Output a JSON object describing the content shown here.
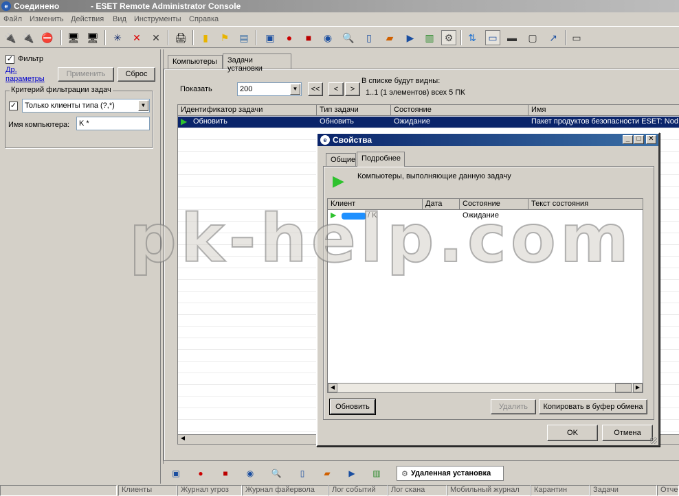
{
  "titlebar": {
    "status": "Соединено",
    "app_title": "- ESET Remote Administrator Console"
  },
  "menu": [
    "Файл",
    "Изменить",
    "Действия",
    "Вид",
    "Инструменты",
    "Справка"
  ],
  "toolbar": {
    "icons": [
      "connect-icon",
      "connect-all-icon",
      "disconnect-icon",
      "computer-icon",
      "computers-icon",
      "new-task-icon",
      "delete-icon",
      "close-icon",
      "print-icon",
      "export-icon",
      "flag-icon",
      "document-icon",
      "clients-icon",
      "threat-icon",
      "firewall-icon",
      "events-icon",
      "scan-icon",
      "mobile-icon",
      "quarantine-icon",
      "tasks-icon",
      "reports-icon",
      "remote-install-icon",
      "refresh-icon",
      "panel-icon",
      "filter-icon",
      "view-icon",
      "send-icon",
      "options-icon"
    ]
  },
  "filter": {
    "enabled_label": "Фильтр",
    "more_link": "Др. параметры",
    "apply_label": "Применить",
    "reset_label": "Сброс",
    "criteria_title": "Критерий фильтрации задач",
    "client_type_value": "Только клиенты типа (?,*)",
    "computer_name_label": "Имя компьютера:",
    "computer_name_value": "K *"
  },
  "tabs": [
    "Компьютеры",
    "Задачи установки"
  ],
  "show": {
    "label": "Показать",
    "value": "200",
    "prev_all": "<<",
    "prev": "<",
    "next": ">",
    "info_line1": "В списке будут видны:",
    "info_line2": "1..1 (1 элементов) всех 5 ПК"
  },
  "tasks_table": {
    "columns": [
      "Идентификатор задачи",
      "Тип задачи",
      "Состояние",
      "Имя"
    ],
    "rows": [
      [
        "Обновить",
        "Обновить",
        "Ожидание",
        "Пакет продуктов безопасности ESET: Nod"
      ]
    ]
  },
  "dialog": {
    "title": "Свойства",
    "tabs": [
      "Общие",
      "Подробнее"
    ],
    "caption": "Компьютеры, выполняющие данную задачу",
    "columns": [
      "Клиент",
      "Дата",
      "Состояние",
      "Текст состояния"
    ],
    "rows": [
      [
        "/ K",
        "",
        "Ожидание",
        ""
      ]
    ],
    "refresh_label": "Обновить",
    "delete_label": "Удалить",
    "copy_label": "Копировать в буфер обмена",
    "ok_label": "OK",
    "cancel_label": "Отмена"
  },
  "watermark": "pk-help.com",
  "bottom_tab_label": "Удаленная установка",
  "statusbar": [
    "Клиенты",
    "Журнал угроз",
    "Журнал файервола",
    "Лог событий",
    "Лог скана",
    "Мобильный журнал",
    "Карантин",
    "Задачи",
    "Отче"
  ],
  "colors": {
    "selection": "#0a246a",
    "dialog_title": "#0a246a",
    "underline": "#e00000",
    "redacted": "#1e90ff"
  }
}
